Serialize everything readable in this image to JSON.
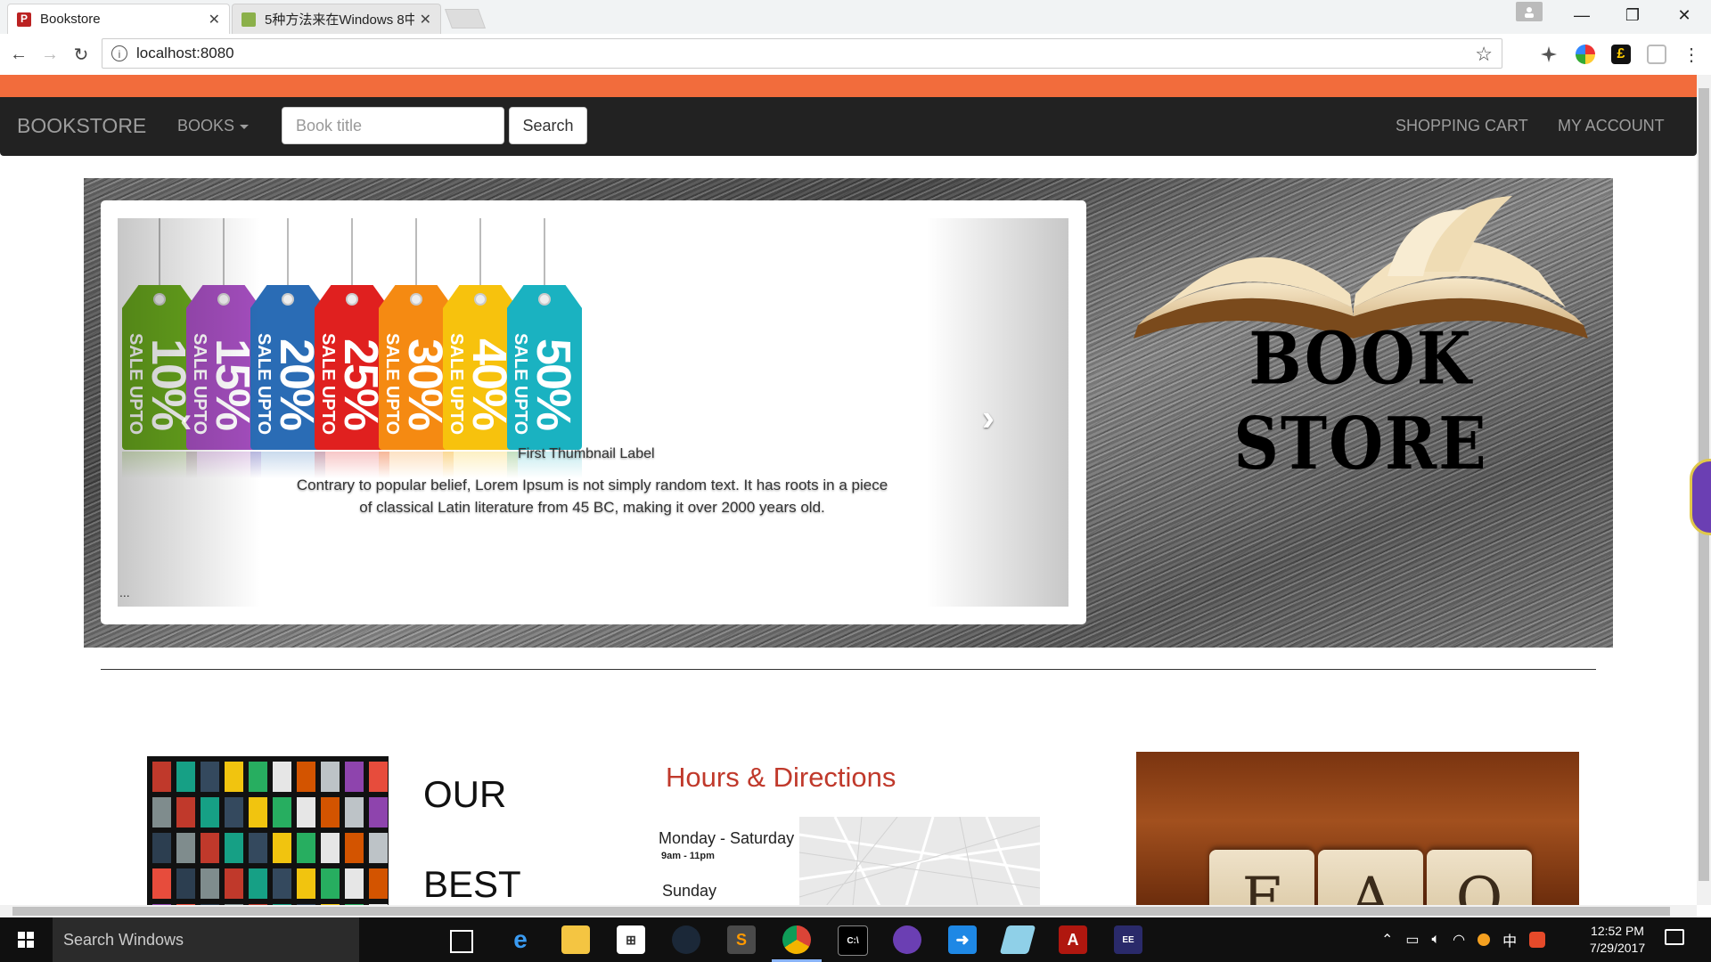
{
  "browser": {
    "tabs": [
      {
        "title": "Bookstore",
        "active": true
      },
      {
        "title": "5种方法来在Windows 8中",
        "active": false
      }
    ],
    "url": "localhost:8080"
  },
  "navbar": {
    "brand": "BOOKSTORE",
    "books_menu": "BOOKS",
    "search_placeholder": "Book title",
    "search_button": "Search",
    "cart_link": "SHOPPING CART",
    "account_link": "MY ACCOUNT"
  },
  "colors": {
    "accent_band": "#f26c3c",
    "navbar_bg": "#222222",
    "hours_title": "#c0392b"
  },
  "carousel": {
    "tags": [
      {
        "sale": "SALE UPTO",
        "percent": "10%",
        "color": "#6aaa1e"
      },
      {
        "sale": "SALE UPTO",
        "percent": "15%",
        "color": "#a24dbc"
      },
      {
        "sale": "SALE UPTO",
        "percent": "20%",
        "color": "#2a6cb5"
      },
      {
        "sale": "SALE UPTO",
        "percent": "25%",
        "color": "#e0201f"
      },
      {
        "sale": "SALE UPTO",
        "percent": "30%",
        "color": "#f58a12"
      },
      {
        "sale": "SALE UPTO",
        "percent": "40%",
        "color": "#f7c20d"
      },
      {
        "sale": "SALE UPTO",
        "percent": "50%",
        "color": "#1ab2c1"
      }
    ],
    "caption_label": "First Thumbnail Label",
    "caption_text": "Contrary to popular belief, Lorem Ipsum is not simply random text. It has roots in a piece of classical Latin literature from 45 BC, making it over 2000 years old.",
    "ellipsis": "...",
    "prev_icon": "chevron-left-icon",
    "next_icon": "chevron-right-icon"
  },
  "logo": {
    "text": "BOOK STORE"
  },
  "bottom": {
    "best_line1": "OUR",
    "best_line2": "BEST",
    "hours_title": "Hours & Directions",
    "weekday_label": "Monday - Saturday",
    "weekday_hours": "9am - 11pm",
    "sunday_label": "Sunday",
    "faq_letters": [
      "F",
      "A",
      "Q"
    ]
  },
  "taskbar": {
    "search_placeholder": "Search Windows",
    "clock_time": "12:52 PM",
    "clock_date": "7/29/2017",
    "ime": "中"
  }
}
